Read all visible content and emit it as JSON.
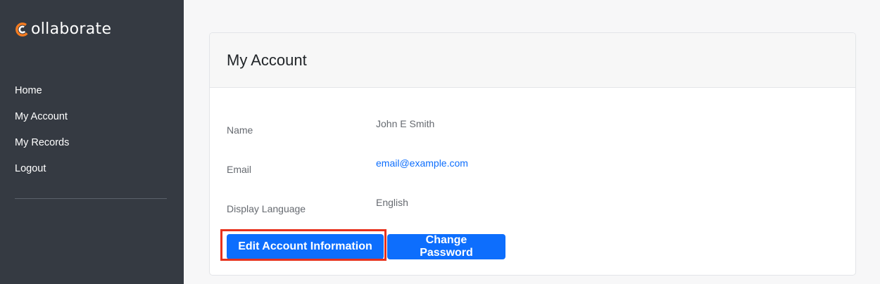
{
  "app": {
    "logo_text": "ollaborate",
    "logo_accent_color": "#f47b20"
  },
  "sidebar": {
    "items": [
      {
        "label": "Home"
      },
      {
        "label": "My Account"
      },
      {
        "label": "My Records"
      },
      {
        "label": "Logout"
      }
    ]
  },
  "main": {
    "title": "My Account",
    "fields": [
      {
        "label": "Name",
        "value": "John E Smith"
      },
      {
        "label": "Email",
        "value": "email@example.com"
      },
      {
        "label": "Display Language",
        "value": "English"
      }
    ],
    "buttons": {
      "edit_label": "Edit Account Information",
      "password_label": "Change Password"
    }
  },
  "colors": {
    "sidebar_bg": "#353a42",
    "primary": "#0d6efd",
    "highlight": "#e8321c"
  }
}
